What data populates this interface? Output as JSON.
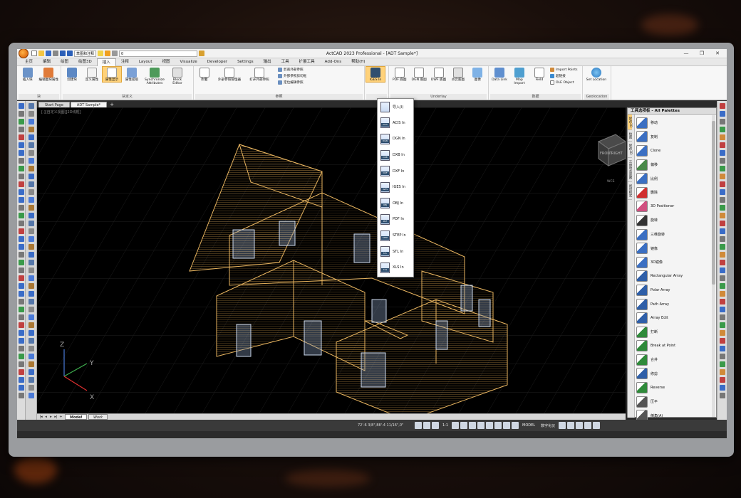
{
  "window": {
    "title": "ActCAD 2023 Professional - [ADT Sample*]",
    "quick_access_combo": "草图和注释",
    "layer_combo": "0",
    "controls": [
      "—",
      "❐",
      "✕"
    ]
  },
  "menu_tabs": [
    "主页",
    "编辑",
    "绘图",
    "绘图3D",
    "插入",
    "注释",
    "Layout",
    "视图",
    "Visualize",
    "Developer",
    "Settings",
    "输出",
    "工具",
    "扩展工具",
    "Add-Ons",
    "帮助(H)"
  ],
  "active_menu_tab": "插入",
  "ribbon": {
    "panels": [
      {
        "title": "块",
        "buttons": [
          "插入块",
          "编辑图块属性"
        ]
      },
      {
        "title": "块定义",
        "buttons": [
          "创建块",
          "定义属性",
          "属性显示",
          "属性提取",
          "Synchronize Attributes",
          "Block Editor"
        ]
      },
      {
        "title": "参照",
        "buttons": [
          "附着",
          "外部参照管理器",
          "打开外部参照"
        ],
        "small": [
          "剪裁外部参照",
          "外部参照剪切框",
          "定位编辑参照"
        ]
      },
      {
        "title": "",
        "buttons": [
          "IGES In"
        ]
      },
      {
        "title": "Underlay",
        "buttons": [
          "PDF 底图",
          "DGN 底图",
          "DWF 底图",
          "点云底图",
          "图像"
        ]
      },
      {
        "title": "数据",
        "buttons": [
          "Data Link",
          "Map Import",
          "Field"
        ],
        "small": [
          "Import Points",
          "超链接",
          "OLE Object"
        ]
      },
      {
        "title": "Geolocation",
        "buttons": [
          "Set Location"
        ]
      }
    ]
  },
  "doc_tabs": [
    "Start Page",
    "ADT Sample*"
  ],
  "active_doc_tab": "ADT Sample*",
  "viewport": {
    "label": "[-][自定义视图][2D线框]",
    "axes": {
      "z": "Z",
      "y": "Y",
      "x": "X"
    },
    "viewcube": {
      "front": "FRONT",
      "right": "RIGHT",
      "label": "WCS"
    }
  },
  "layout_tabs": [
    "Model",
    "Work"
  ],
  "active_layout_tab": "Model",
  "status": {
    "coords": "72'-6 3/8\",88'-4 11/16\",0\"",
    "scale": "1:1",
    "mode": "MODEL",
    "lang": "数字化仪"
  },
  "import_dropdown": {
    "items": [
      {
        "label": "导入(I)",
        "badge": ""
      },
      {
        "label": "ACIS In",
        "badge": "ACIS"
      },
      {
        "label": "DGN In",
        "badge": "DGN"
      },
      {
        "label": "DXB In",
        "badge": "DXB"
      },
      {
        "label": "DXF In",
        "badge": "DXF"
      },
      {
        "label": "IGES In",
        "badge": "IGES"
      },
      {
        "label": "OBJ In",
        "badge": "OBJ"
      },
      {
        "label": "PDF In",
        "badge": "PDF"
      },
      {
        "label": "STEP In",
        "badge": "STEP"
      },
      {
        "label": "STL In",
        "badge": "STL"
      },
      {
        "label": "XLS In",
        "badge": "XLS"
      }
    ]
  },
  "palette": {
    "title": "工具选项板 - All Palettes",
    "side_tabs": [
      "修改2D",
      "绘图",
      "修改3D",
      "三维动态观察",
      "视觉样式"
    ],
    "items": [
      "移动",
      "复制",
      "Clone",
      "偏移",
      "比例",
      "删除",
      "3D Positioner",
      "旋转",
      "三维旋转",
      "镜像",
      "3D镜像",
      "Rectangular Array",
      "Polar Array",
      "Path Array",
      "Array Edit",
      "打断",
      "Break at Point",
      "合并",
      "修剪",
      "Reverse",
      "压平",
      "倒角(A)"
    ]
  },
  "colors": {
    "accent": "#ffd27a",
    "house": "#e8b560",
    "window": "#c9d6ea"
  }
}
